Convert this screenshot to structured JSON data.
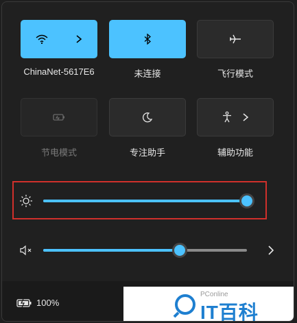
{
  "tiles": [
    {
      "label": "ChinaNet-5617E6",
      "icon": "wifi-icon",
      "state": "on",
      "expand": true
    },
    {
      "label": "未连接",
      "icon": "bluetooth-icon",
      "state": "on",
      "expand": false
    },
    {
      "label": "飞行模式",
      "icon": "airplane-icon",
      "state": "off",
      "expand": false
    },
    {
      "label": "节电模式",
      "icon": "battery-saver-icon",
      "state": "disabled",
      "expand": false
    },
    {
      "label": "专注助手",
      "icon": "moon-icon",
      "state": "off",
      "expand": false
    },
    {
      "label": "辅助功能",
      "icon": "accessibility-icon",
      "state": "off",
      "expand": true
    }
  ],
  "brightness": {
    "icon": "sun-icon",
    "level": 1.0
  },
  "volume": {
    "icon": "speaker-muted-icon",
    "level": 0.67
  },
  "battery": {
    "icon": "battery-charging-icon",
    "text": "100%"
  },
  "watermark": {
    "top": "PConline",
    "main": "IT百科"
  },
  "colors": {
    "accent": "#4cc2ff",
    "highlight": "#d1302b",
    "background": "#202020"
  }
}
